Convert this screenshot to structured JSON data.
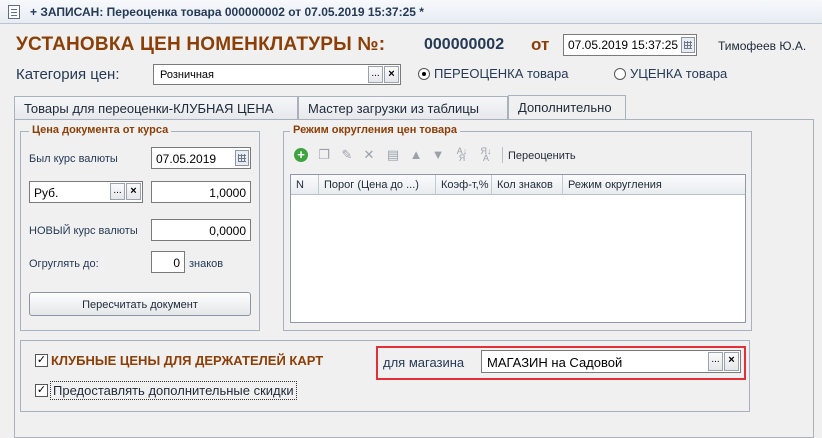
{
  "window": {
    "title": "+ ЗАПИСАН: Переоценка товара 000000002 от 07.05.2019 15:37:25 *"
  },
  "header": {
    "title": "УСТАНОВКА ЦЕН НОМЕНКЛАТУРЫ №:",
    "number": "000000002",
    "from_label": "от",
    "date": "07.05.2019 15:37:25",
    "user": "Тимофеев Ю.А."
  },
  "category": {
    "label": "Категория цен:",
    "value": "Розничная",
    "dots": "...",
    "clear": "×"
  },
  "mode": {
    "revaluation_label": "ПЕРЕОЦЕНКА товара",
    "discount_label": "УЦЕНКА товара",
    "selected": "revaluation"
  },
  "tabs": [
    {
      "label": "Товары для переоценки-КЛУБНАЯ ЦЕНА"
    },
    {
      "label": "Мастер загрузки из таблицы"
    },
    {
      "label": "Дополнительно"
    }
  ],
  "price_from_rate": {
    "title": "Цена документа от курса",
    "was_rate_label": "Был курс валюты",
    "was_rate_date": "07.05.2019",
    "currency": "Руб.",
    "currency_dots": "...",
    "currency_clear": "×",
    "rate_value": "1,0000",
    "new_rate_label": "НОВЫЙ курс валюты",
    "new_rate_value": "0,0000",
    "round_label": "Огруглять до:",
    "round_value": "0",
    "round_unit": "знаков",
    "recalc_button": "Пересчитать документ"
  },
  "rounding": {
    "title": "Режим округления цен товара",
    "toolbar_icons": [
      "add-icon",
      "copy-icon",
      "edit-icon",
      "delete-icon",
      "save-icon",
      "move-up-icon",
      "move-down-icon",
      "sort-asc-icon",
      "sort-desc-icon"
    ],
    "revalue_label": "Переоценить",
    "columns": [
      "N",
      "Порог (Цена до ...)",
      "Коэф-т,%",
      "Кол знаков",
      "Режим округления"
    ]
  },
  "club": {
    "checked": true,
    "label": "КЛУБНЫЕ ЦЕНЫ ДЛЯ ДЕРЖАТЕЛЕЙ КАРТ",
    "store_label": "для магазина",
    "store_value": "МАГАЗИН на Садовой",
    "store_dots": "...",
    "store_clear": "×",
    "extra_discounts_checked": true,
    "extra_discounts_label": "Предоставлять дополнительные скидки"
  },
  "colors": {
    "accent": "#8b3f06",
    "text_blue": "#253a55",
    "highlight_border": "#e0303a"
  }
}
